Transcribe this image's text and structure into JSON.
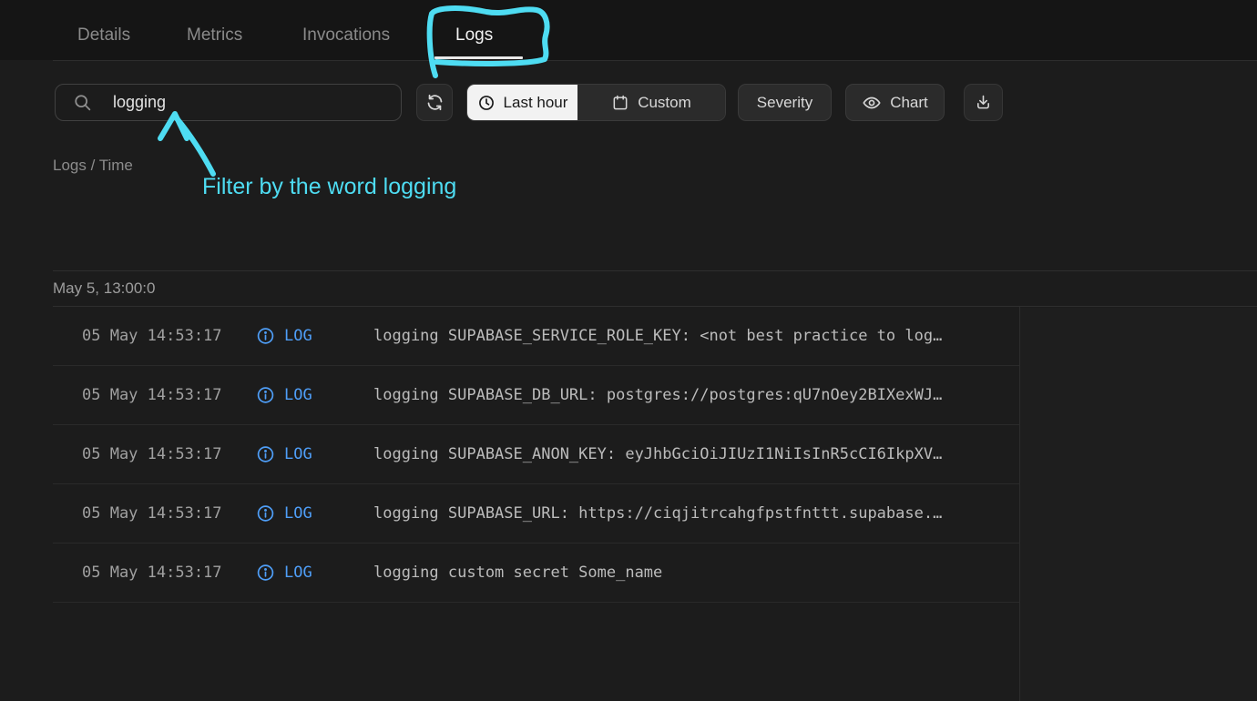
{
  "tabs": [
    {
      "label": "Details",
      "active": false
    },
    {
      "label": "Metrics",
      "active": false
    },
    {
      "label": "Invocations",
      "active": false
    },
    {
      "label": "Logs",
      "active": true
    }
  ],
  "toolbar": {
    "search_value": "logging",
    "time_range_label": "Last hour",
    "custom_label": "Custom",
    "severity_label": "Severity",
    "chart_label": "Chart"
  },
  "breadcrumb": "Logs / Time",
  "annotation": {
    "text": "Filter by the word logging",
    "color": "#4edcf2"
  },
  "logs": {
    "group_header": "May 5, 13:00:0",
    "rows": [
      {
        "timestamp": "05 May 14:53:17",
        "level": "LOG",
        "message": "logging SUPABASE_SERVICE_ROLE_KEY: <not best practice to log…"
      },
      {
        "timestamp": "05 May 14:53:17",
        "level": "LOG",
        "message": "logging SUPABASE_DB_URL: postgres://postgres:qU7nOey2BIXexWJ…"
      },
      {
        "timestamp": "05 May 14:53:17",
        "level": "LOG",
        "message": "logging SUPABASE_ANON_KEY: eyJhbGciOiJIUzI1NiIsInR5cCI6IkpXV…"
      },
      {
        "timestamp": "05 May 14:53:17",
        "level": "LOG",
        "message": "logging SUPABASE_URL: https://ciqjitrcahgfpstfnttt.supabase.…"
      },
      {
        "timestamp": "05 May 14:53:17",
        "level": "LOG",
        "message": "logging custom secret Some_name"
      }
    ]
  },
  "colors": {
    "log_level_blue": "#4f9ff9",
    "annotation_cyan": "#4edcf2",
    "active_tab_underline": "#e8e8e8",
    "selected_segment_bg": "#f2f2f2"
  }
}
